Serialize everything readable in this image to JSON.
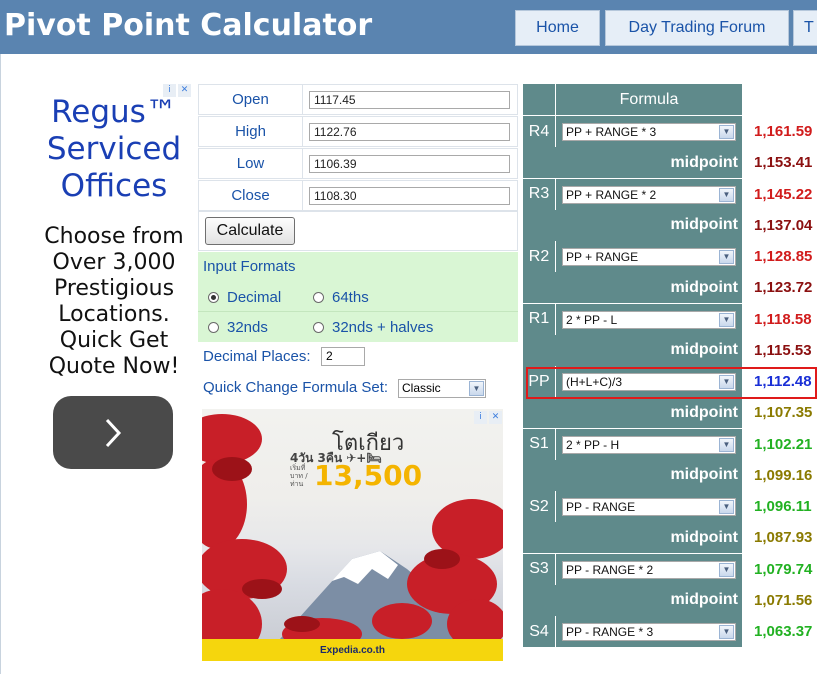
{
  "header": {
    "title": "Pivot Point Calculator",
    "nav": [
      {
        "label": "Home"
      },
      {
        "label": "Day Trading Forum"
      },
      {
        "label": "T"
      }
    ]
  },
  "ad_left": {
    "brand": "Regus™ Serviced Offices",
    "copy": "Choose from Over 3,000 Prestigious Locations. Quick Get Quote Now!",
    "adchoices_icon": "info-icon",
    "close_icon": "close-icon",
    "arrow_icon": "chevron-right-icon"
  },
  "inputs": {
    "open_label": "Open",
    "open_value": "1117.45",
    "high_label": "High",
    "high_value": "1122.76",
    "low_label": "Low",
    "low_value": "1106.39",
    "close_label": "Close",
    "close_value": "1108.30",
    "calculate_label": "Calculate"
  },
  "input_formats": {
    "title": "Input Formats",
    "options": [
      {
        "label": "Decimal",
        "selected": true
      },
      {
        "label": "64ths",
        "selected": false
      },
      {
        "label": "32nds",
        "selected": false
      },
      {
        "label": "32nds + halves",
        "selected": false
      }
    ]
  },
  "decimal_places": {
    "label": "Decimal Places:",
    "value": "2"
  },
  "quick_change": {
    "label": "Quick Change Formula Set:",
    "value": "Classic"
  },
  "ad2": {
    "city": "โตเกียว",
    "days": "4วัน 3คืน ✈+🛏",
    "from": "เริ่มที่ บาท /ท่าน",
    "price": "13,500",
    "brand": "Expedia.co.th"
  },
  "pivot": {
    "formula_header": "Formula",
    "mid_label": "midpoint",
    "rows": [
      {
        "label": "R4",
        "formula": "PP + RANGE * 3",
        "value": "1,161.59",
        "mid": "1,153.41"
      },
      {
        "label": "R3",
        "formula": "PP + RANGE * 2",
        "value": "1,145.22",
        "mid": "1,137.04"
      },
      {
        "label": "R2",
        "formula": "PP + RANGE",
        "value": "1,128.85",
        "mid": "1,123.72"
      },
      {
        "label": "R1",
        "formula": "2 * PP - L",
        "value": "1,118.58",
        "mid": "1,115.53"
      },
      {
        "label": "PP",
        "formula": "(H+L+C)/3",
        "value": "1,112.48",
        "mid": "1,107.35"
      },
      {
        "label": "S1",
        "formula": "2 * PP - H",
        "value": "1,102.21",
        "mid": "1,099.16"
      },
      {
        "label": "S2",
        "formula": "PP - RANGE",
        "value": "1,096.11",
        "mid": "1,087.93"
      },
      {
        "label": "S3",
        "formula": "PP - RANGE * 2",
        "value": "1,079.74",
        "mid": "1,071.56"
      },
      {
        "label": "S4",
        "formula": "PP - RANGE * 3",
        "value": "1,063.37",
        "mid": ""
      }
    ],
    "colors": {
      "resistance": "#d11c1c",
      "resistance_mid": "#8b1010",
      "pivot": "#1a2fd6",
      "support_mid": "#8a7a00",
      "support": "#22b122"
    }
  }
}
